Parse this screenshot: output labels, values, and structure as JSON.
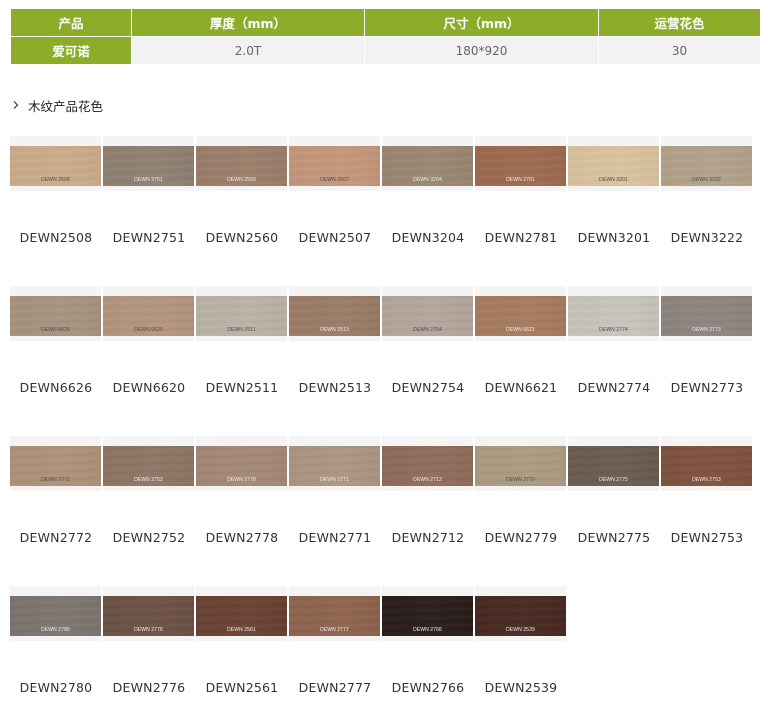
{
  "spec_table": {
    "headers": [
      "产品",
      "厚度（mm）",
      "尺寸（mm）",
      "运营花色"
    ],
    "row": [
      "爱可诺",
      "2.0T",
      "180*920",
      "30"
    ]
  },
  "section": {
    "heading": "木纹产品花色"
  },
  "colors": {
    "table_green": "#8cad2a",
    "table_value_bg": "#f2f2f2"
  },
  "swatch_rows": [
    {
      "items": [
        {
          "code": "DEWN2508",
          "board_label": "DEWN 2508",
          "color": "#c9ab8c",
          "tone": "light"
        },
        {
          "code": "DEWN2751",
          "board_label": "DEWN 2751",
          "color": "#8f8172",
          "tone": "dark"
        },
        {
          "code": "DEWN2560",
          "board_label": "DEWN 2560",
          "color": "#9b7e6b",
          "tone": "dark"
        },
        {
          "code": "DEWN2507",
          "board_label": "DEWN 2507",
          "color": "#c2967a",
          "tone": "light"
        },
        {
          "code": "DEWN3204",
          "board_label": "DEWN 3204",
          "color": "#998673",
          "tone": "dark"
        },
        {
          "code": "DEWN2781",
          "board_label": "DEWN 2781",
          "color": "#9d6a52",
          "tone": "dark"
        },
        {
          "code": "DEWN3201",
          "board_label": "DEWN 3201",
          "color": "#d6c09d",
          "tone": "light"
        },
        {
          "code": "DEWN3222",
          "board_label": "DEWN 3222",
          "color": "#b1a08a",
          "tone": "light"
        }
      ]
    },
    {
      "items": [
        {
          "code": "DEWN6626",
          "board_label": "DEWN 6626",
          "color": "#a5927f",
          "tone": "light"
        },
        {
          "code": "DEWN6620",
          "board_label": "DEWN 6620",
          "color": "#b3947d",
          "tone": "light"
        },
        {
          "code": "DEWN2511",
          "board_label": "DEWN 2511",
          "color": "#bab1a6",
          "tone": "light"
        },
        {
          "code": "DEWN2513",
          "board_label": "DEWN 2513",
          "color": "#9b7c68",
          "tone": "dark"
        },
        {
          "code": "DEWN2754",
          "board_label": "DEWN 2754",
          "color": "#b2a59b",
          "tone": "light"
        },
        {
          "code": "DEWN6621",
          "board_label": "DEWN 6621",
          "color": "#a67c61",
          "tone": "dark"
        },
        {
          "code": "DEWN2774",
          "board_label": "DEWN 2774",
          "color": "#c5c1bb",
          "tone": "light"
        },
        {
          "code": "DEWN2773",
          "board_label": "DEWN 2773",
          "color": "#8c8580",
          "tone": "dark"
        }
      ]
    },
    {
      "items": [
        {
          "code": "DEWN2772",
          "board_label": "DEWN 2772",
          "color": "#ad9179",
          "tone": "light"
        },
        {
          "code": "DEWN2752",
          "board_label": "DEWN 2752",
          "color": "#8d7666",
          "tone": "dark"
        },
        {
          "code": "DEWN2778",
          "board_label": "DEWN 2778",
          "color": "#a48877",
          "tone": "dark"
        },
        {
          "code": "DEWN2771",
          "board_label": "DEWN 2771",
          "color": "#ab9582",
          "tone": "dark"
        },
        {
          "code": "DEWN2712",
          "board_label": "DEWN 2712",
          "color": "#8e6d5d",
          "tone": "dark"
        },
        {
          "code": "DEWN2779",
          "board_label": "DEWN 2779",
          "color": "#aa9a82",
          "tone": "light"
        },
        {
          "code": "DEWN2775",
          "board_label": "DEWN 2775",
          "color": "#6c5d52",
          "tone": "dark"
        },
        {
          "code": "DEWN2753",
          "board_label": "DEWN 2753",
          "color": "#7f5440",
          "tone": "dark"
        }
      ]
    },
    {
      "items": [
        {
          "code": "DEWN2780",
          "board_label": "DEWN 2780",
          "color": "#7d7670",
          "tone": "dark"
        },
        {
          "code": "DEWN2776",
          "board_label": "DEWN 2776",
          "color": "#6e5349",
          "tone": "dark"
        },
        {
          "code": "DEWN2561",
          "board_label": "DEWN 2561",
          "color": "#6a4536",
          "tone": "dark"
        },
        {
          "code": "DEWN2777",
          "board_label": "DEWN 2777",
          "color": "#8e6550",
          "tone": "dark"
        },
        {
          "code": "DEWN2766",
          "board_label": "DEWN 2766",
          "color": "#2c211e",
          "tone": "dark"
        },
        {
          "code": "DEWN2539",
          "board_label": "DEWN 2539",
          "color": "#4a2d24",
          "tone": "dark"
        }
      ]
    }
  ]
}
